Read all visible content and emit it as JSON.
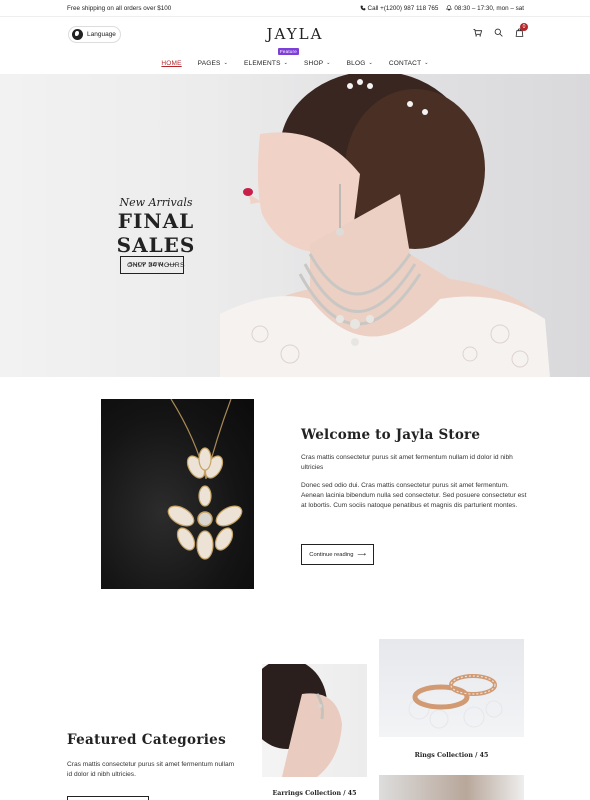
{
  "topbar": {
    "shipping": "Free shipping on all orders over $100",
    "phone": "Call +(1200) 987 118 765",
    "hours": "08:30 – 17:30, mon – sat"
  },
  "header": {
    "language": "Language",
    "logo": "JAYLA",
    "cart_count": "0"
  },
  "nav": {
    "items": [
      {
        "label": "HOME",
        "active": true
      },
      {
        "label": "PAGES"
      },
      {
        "label": "ELEMENTS",
        "badge": "Feature"
      },
      {
        "label": "SHOP"
      },
      {
        "label": "BLOG"
      },
      {
        "label": "CONTACT"
      }
    ]
  },
  "hero": {
    "subtitle": "New Arrivals",
    "title": "FINAL SALES",
    "tagline": "ONLY 24 HOURS",
    "button": "SHOP NOW"
  },
  "welcome": {
    "title": "Welcome to Jayla Store",
    "p1": "Cras mattis consectetur purus sit amet fermentum nullam id dolor id nibh ultricies",
    "p2": "Donec sed odio dui. Cras mattis consectetur purus sit amet fermentum. Aenean lacinia bibendum nulla sed consectetur. Sed posuere consectetur est at lobortis. Cum sociis natoque penatibus et magnis dis parturient montes.",
    "button": "Continue reading"
  },
  "featured": {
    "title": "Featured Categories",
    "description": "Cras mattis consectetur purus sit amet fermentum nullam id dolor id nibh ultricies.",
    "rings_caption": "Rings Collection / 45",
    "earrings_caption": "Earrings Collection / 45"
  },
  "colors": {
    "accent": "#b3262b",
    "feature_badge": "#7e3fd6"
  }
}
